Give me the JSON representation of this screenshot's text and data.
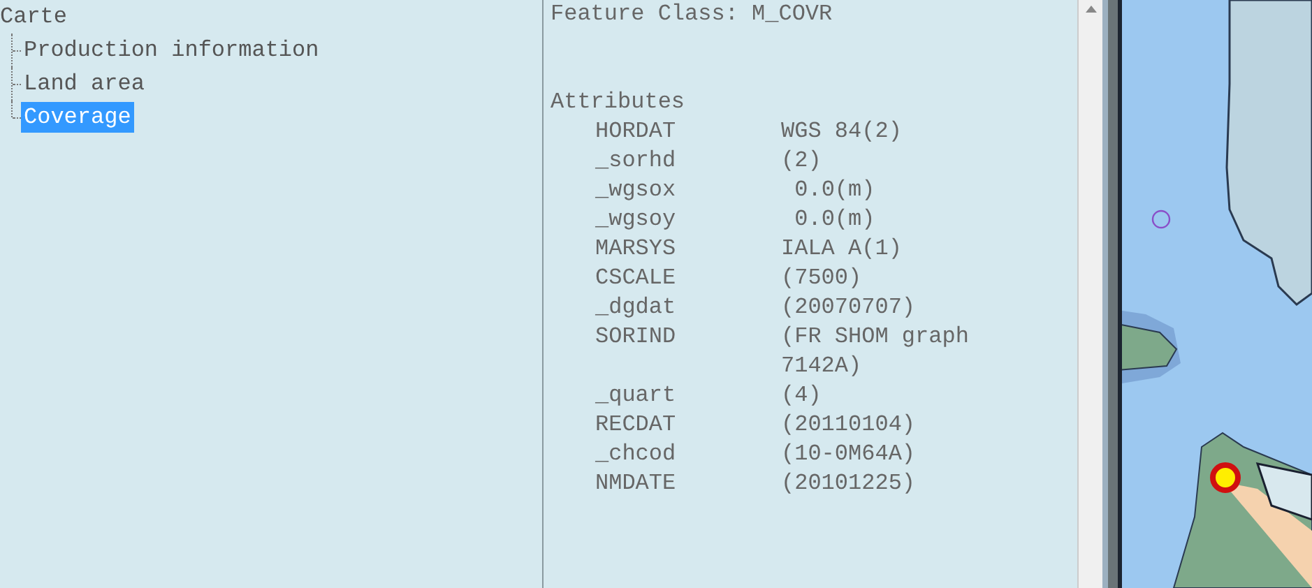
{
  "tree": {
    "root": "Carte",
    "children": [
      {
        "label": "Production information",
        "selected": false
      },
      {
        "label": "Land area",
        "selected": false
      },
      {
        "label": "Coverage",
        "selected": true
      }
    ]
  },
  "details": {
    "feature_class": "Feature Class: M_COVR",
    "attributes_heading": "Attributes",
    "attributes": [
      {
        "name": "HORDAT",
        "value": "WGS 84(2)"
      },
      {
        "name": "_sorhd",
        "value": "(2)"
      },
      {
        "name": "_wgsox",
        "value": " 0.0(m)"
      },
      {
        "name": "_wgsoy",
        "value": " 0.0(m)"
      },
      {
        "name": "MARSYS",
        "value": "IALA A(1)"
      },
      {
        "name": "CSCALE",
        "value": "(7500)"
      },
      {
        "name": "_dgdat",
        "value": "(20070707)"
      },
      {
        "name": "SORIND",
        "value": "(FR SHOM graph 7142A)"
      },
      {
        "name": "_quart",
        "value": "(4)"
      },
      {
        "name": "RECDAT",
        "value": "(20110104)"
      },
      {
        "name": "_chcod",
        "value": "(10-0M64A)"
      },
      {
        "name": "NMDATE",
        "value": "(20101225)"
      }
    ]
  }
}
